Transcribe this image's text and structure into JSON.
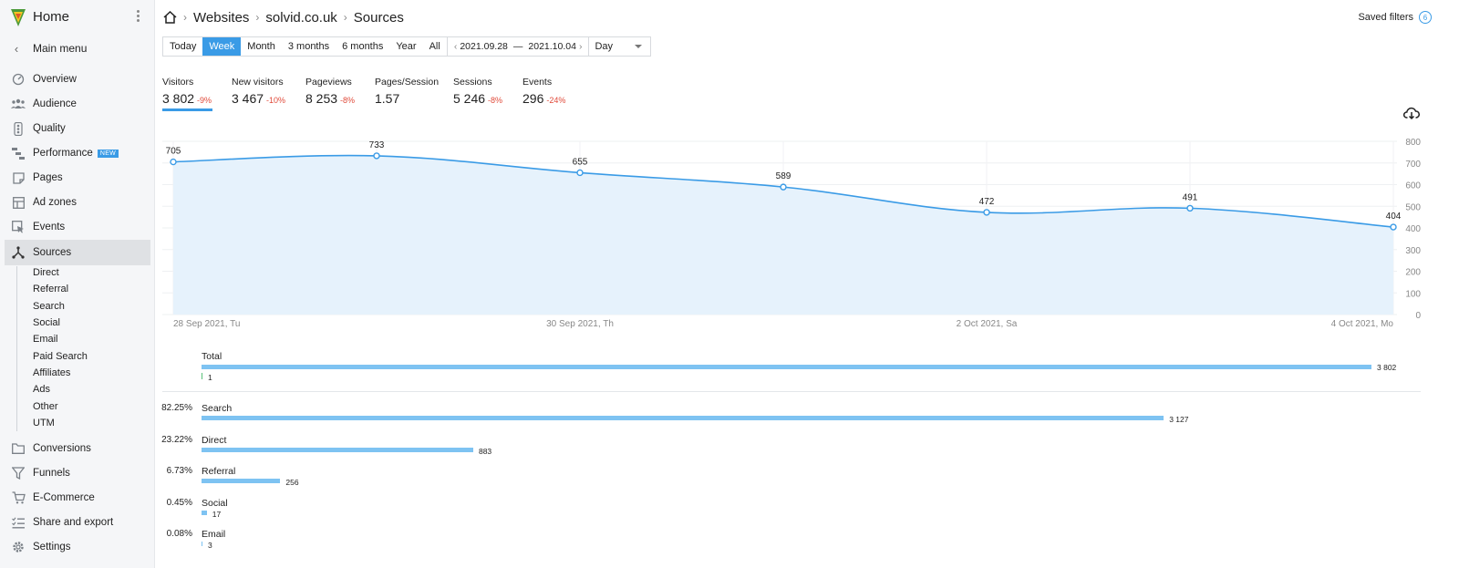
{
  "sidebar": {
    "home_title": "Home",
    "main_menu": "Main menu",
    "items": [
      {
        "label": "Overview",
        "icon": "gauge-icon"
      },
      {
        "label": "Audience",
        "icon": "people-icon"
      },
      {
        "label": "Quality",
        "icon": "traffic-light-icon"
      },
      {
        "label": "Performance",
        "icon": "performance-icon",
        "badge": "NEW"
      },
      {
        "label": "Pages",
        "icon": "page-icon"
      },
      {
        "label": "Ad zones",
        "icon": "layout-icon"
      },
      {
        "label": "Events",
        "icon": "cursor-icon"
      },
      {
        "label": "Sources",
        "icon": "sources-icon",
        "active": true
      }
    ],
    "sub_items": [
      "Direct",
      "Referral",
      "Search",
      "Social",
      "Email",
      "Paid Search",
      "Affiliates",
      "Ads",
      "Other",
      "UTM"
    ],
    "items_after": [
      {
        "label": "Conversions",
        "icon": "folder-icon"
      },
      {
        "label": "Funnels",
        "icon": "funnel-icon"
      },
      {
        "label": "E-Commerce",
        "icon": "cart-icon"
      },
      {
        "label": "Share and export",
        "icon": "checklist-icon"
      },
      {
        "label": "Settings",
        "icon": "gear-icon"
      }
    ]
  },
  "breadcrumb": [
    "Websites",
    "solvid.co.uk",
    "Sources"
  ],
  "saved_filters": {
    "label": "Saved filters",
    "count": "6"
  },
  "toolbar": {
    "periods": [
      "Today",
      "Week",
      "Month",
      "3 months",
      "6 months",
      "Year",
      "All"
    ],
    "active_period": "Week",
    "date_from": "2021.09.28",
    "date_to": "2021.10.04",
    "date_sep": "—",
    "granularity": "Day"
  },
  "metrics": [
    {
      "label": "Visitors",
      "value": "3 802",
      "change": "-9%"
    },
    {
      "label": "New visitors",
      "value": "3 467",
      "change": "-10%"
    },
    {
      "label": "Pageviews",
      "value": "8 253",
      "change": "-8%"
    },
    {
      "label": "Pages/Session",
      "value": "1.57",
      "change": ""
    },
    {
      "label": "Sessions",
      "value": "5 246",
      "change": "-8%"
    },
    {
      "label": "Events",
      "value": "296",
      "change": "-24%"
    }
  ],
  "chart_data": {
    "type": "area",
    "x": [
      "2021-09-28",
      "2021-09-29",
      "2021-09-30",
      "2021-10-01",
      "2021-10-02",
      "2021-10-03",
      "2021-10-04"
    ],
    "values": [
      705,
      733,
      655,
      589,
      472,
      491,
      404
    ],
    "data_labels": [
      "705",
      "733",
      "655",
      "589",
      "472",
      "491",
      "404"
    ],
    "x_tick_labels": [
      {
        "index": 0,
        "label": "28 Sep 2021, Tu"
      },
      {
        "index": 2,
        "label": "30 Sep 2021, Th"
      },
      {
        "index": 4,
        "label": "2 Oct 2021, Sa"
      },
      {
        "index": 6,
        "label": "4 Oct 2021, Mo"
      }
    ],
    "y_ticks": [
      "800",
      "700",
      "600",
      "500",
      "400",
      "300",
      "200",
      "100",
      "0"
    ],
    "ylim": [
      0,
      800
    ],
    "y_axis_side": "right",
    "grid": true,
    "line_color": "#3a9be6",
    "fill_color": "#e6f2fc"
  },
  "sources_total": {
    "label": "Total",
    "value": "3 802",
    "value_num": 3802,
    "secondary": "1"
  },
  "sources": [
    {
      "pct": "82.25%",
      "name": "Search",
      "value": "3 127",
      "value_num": 3127
    },
    {
      "pct": "23.22%",
      "name": "Direct",
      "value": "883",
      "value_num": 883
    },
    {
      "pct": "6.73%",
      "name": "Referral",
      "value": "256",
      "value_num": 256
    },
    {
      "pct": "0.45%",
      "name": "Social",
      "value": "17",
      "value_num": 17
    },
    {
      "pct": "0.08%",
      "name": "Email",
      "value": "3",
      "value_num": 3
    }
  ],
  "colors": {
    "accent": "#3a9be6",
    "bar": "#7ec3f2",
    "negative": "#e04a3a",
    "positive_tick": "#5ac27a"
  }
}
